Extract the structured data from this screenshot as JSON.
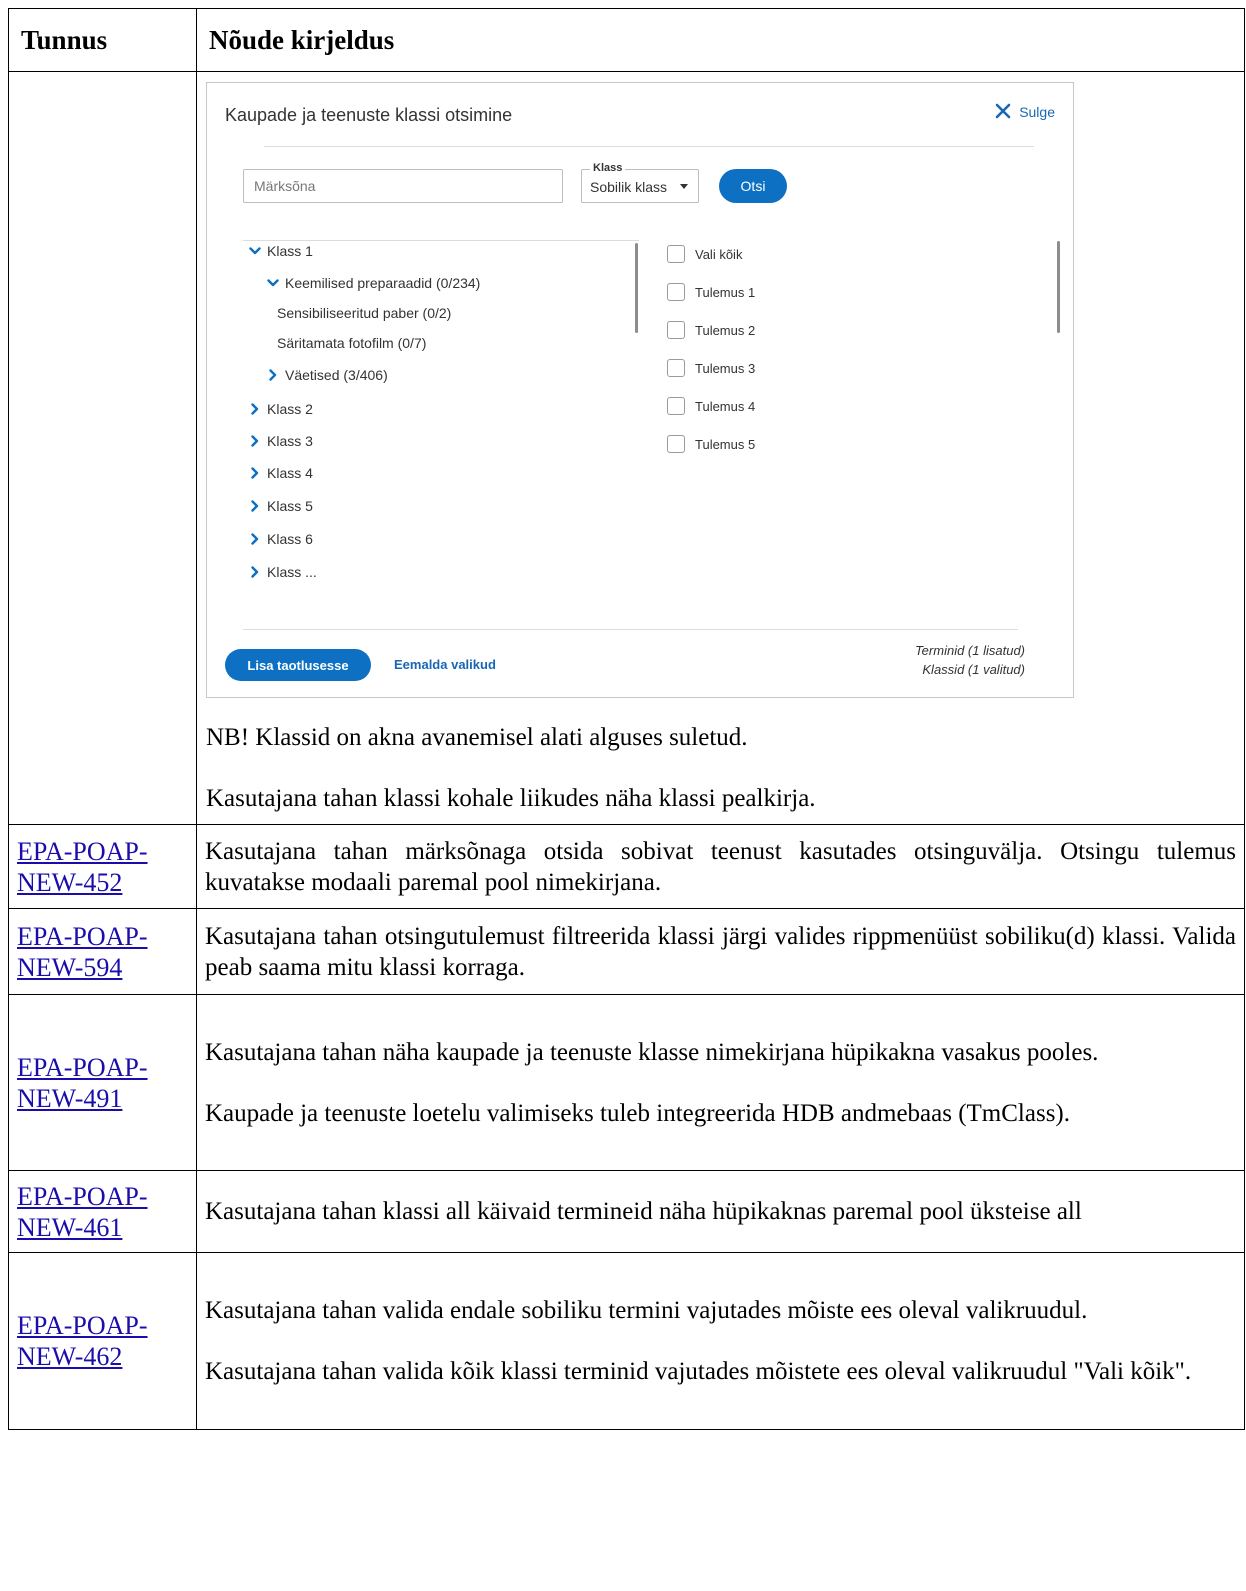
{
  "table": {
    "header": {
      "id_col": "Tunnus",
      "desc_col": "Nõude kirjeldus"
    },
    "first_row": {
      "note1": "NB! Klassid on akna avanemisel alati alguses suletud.",
      "note2": "Kasutajana tahan klassi kohale liikudes näha klassi pealkirja."
    },
    "rows": [
      {
        "id": "EPA-POAP-NEW-452",
        "id_line1": "EPA-POAP-",
        "id_line2": "NEW-452",
        "paras": [
          "Kasutajana tahan märksõnaga otsida sobivat teenust kasutades otsinguvälja. Otsingu tulemus kuvatakse modaali paremal pool nimekirjana."
        ]
      },
      {
        "id": "EPA-POAP-NEW-594",
        "id_line1": "EPA-POAP-",
        "id_line2": "NEW-594",
        "paras": [
          "Kasutajana tahan otsingutulemust filtreerida klassi järgi valides rippmenüüst sobiliku(d) klassi. Valida peab saama mitu klassi korraga."
        ]
      },
      {
        "id": "EPA-POAP-NEW-491",
        "id_line1": "EPA-POAP-",
        "id_line2": "NEW-491",
        "paras": [
          "Kasutajana tahan näha kaupade ja teenuste klasse nimekirjana hüpikakna vasakus pooles.",
          "Kaupade ja teenuste loetelu valimiseks tuleb integreerida HDB andmebaas (TmClass)."
        ]
      },
      {
        "id": "EPA-POAP-NEW-461",
        "id_line1": "EPA-POAP-",
        "id_line2": "NEW-461",
        "paras": [
          "Kasutajana tahan klassi all käivaid termineid näha hüpikaknas paremal pool üksteise all"
        ]
      },
      {
        "id": "EPA-POAP-NEW-462",
        "id_line1": "EPA-POAP-",
        "id_line2": "NEW-462",
        "paras": [
          "Kasutajana tahan valida endale sobiliku termini vajutades mõiste ees oleval valikruudul.",
          "Kasutajana tahan valida kõik klassi terminid vajutades mõistete ees oleval valikruudul \"Vali kõik\"."
        ]
      }
    ]
  },
  "modal": {
    "title": "Kaupade ja teenuste klassi otsimine",
    "close_label": "Sulge",
    "close_icon": "close-x-icon",
    "search_placeholder": "Märksõna",
    "class_select_label": "Klass",
    "class_select_value": "Sobilik klass",
    "search_button": "Otsi",
    "tree": [
      {
        "label": "Klass 1",
        "level": 0,
        "state": "expanded"
      },
      {
        "label": "Keemilised preparaadid (0/234)",
        "level": 1,
        "state": "expanded"
      },
      {
        "label": "Sensibiliseeritud paber (0/2)",
        "level": 2,
        "state": "leaf"
      },
      {
        "label": "Säritamata fotofilm (0/7)",
        "level": 2,
        "state": "leaf"
      },
      {
        "label": "Väetised (3/406)",
        "level": 1,
        "state": "collapsed"
      },
      {
        "label": "Klass 2",
        "level": 0,
        "state": "collapsed"
      },
      {
        "label": "Klass 3",
        "level": 0,
        "state": "collapsed"
      },
      {
        "label": "Klass 4",
        "level": 0,
        "state": "collapsed"
      },
      {
        "label": "Klass 5",
        "level": 0,
        "state": "collapsed"
      },
      {
        "label": "Klass 6",
        "level": 0,
        "state": "collapsed"
      },
      {
        "label": "Klass ...",
        "level": 0,
        "state": "collapsed"
      }
    ],
    "results": [
      "Vali kõik",
      "Tulemus 1",
      "Tulemus 2",
      "Tulemus 3",
      "Tulemus 4",
      "Tulemus 5"
    ],
    "add_button": "Lisa taotlusesse",
    "remove_link": "Eemalda valikud",
    "summary_terms": "Terminid (1 lisatud)",
    "summary_classes": "Klassid (1 valitud)",
    "accent_color": "#0d70c2"
  }
}
